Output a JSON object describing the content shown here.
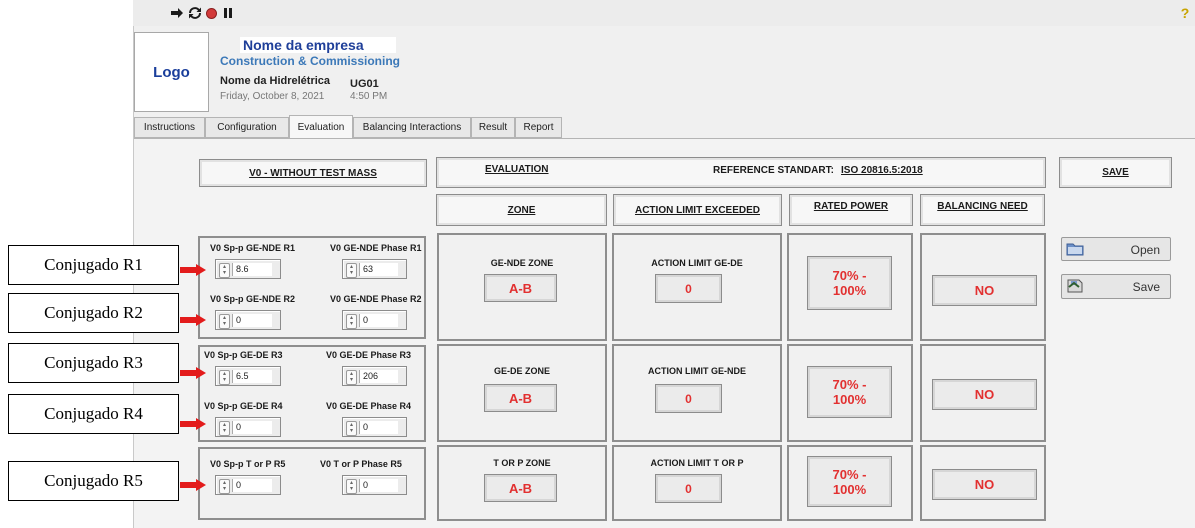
{
  "toolbar": {
    "icons": [
      "run-arrow-icon",
      "run-continuous-icon",
      "abort-icon",
      "pause-icon",
      "help-icon"
    ],
    "help_glyph": "?"
  },
  "header": {
    "logo": "Logo",
    "company_name": "Nome da empresa",
    "company_subtitle": "Construction & Commissioning",
    "plant_name": "Nome da Hidrelétrica",
    "date": "Friday, October 8, 2021",
    "unit": "UG01",
    "time": "4:50 PM"
  },
  "tabs": [
    {
      "label": "Instructions"
    },
    {
      "label": "Configuration"
    },
    {
      "label": "Evaluation",
      "active": true
    },
    {
      "label": "Balancing Interactions"
    },
    {
      "label": "Result"
    },
    {
      "label": "Report"
    }
  ],
  "evaluation": {
    "v0_title": "V0 - WITHOUT TEST MASS",
    "evaluation_title": "EVALUATION",
    "reference_label": "REFERENCE STANDART:",
    "reference_value": "ISO 20816.5:2018",
    "save_header": "SAVE",
    "columns": {
      "zone": "ZONE",
      "action": "ACTION LIMIT EXCEEDED",
      "rated": "RATED POWER",
      "balancing": "BALANCING NEED"
    },
    "inputs": [
      {
        "sp_label": "V0 Sp-p GE-NDE R1",
        "sp_value": "8.6",
        "ph_label": "V0 GE-NDE Phase R1",
        "ph_value": "63"
      },
      {
        "sp_label": "V0 Sp-p GE-NDE R2",
        "sp_value": "0",
        "ph_label": "V0 GE-NDE Phase R2",
        "ph_value": "0"
      },
      {
        "sp_label": "V0 Sp-p GE-DE R3",
        "sp_value": "6.5",
        "ph_label": "V0 GE-DE  Phase R3",
        "ph_value": "206"
      },
      {
        "sp_label": "V0 Sp-p GE-DE R4",
        "sp_value": "0",
        "ph_label": "V0 GE-DE Phase R4",
        "ph_value": "0"
      },
      {
        "sp_label": "V0 Sp-p  T or P R5",
        "sp_value": "0",
        "ph_label": "V0 T or P Phase R5",
        "ph_value": "0"
      }
    ],
    "rows": [
      {
        "zone_label": "GE-NDE ZONE",
        "zone_value": "A-B",
        "action_label": "ACTION LIMIT GE-DE",
        "action_value": "0",
        "rated_value": "70% - 100%",
        "balancing_value": "NO"
      },
      {
        "zone_label": "GE-DE ZONE",
        "zone_value": "A-B",
        "action_label": "ACTION LIMIT GE-NDE",
        "action_value": "0",
        "rated_value": "70% - 100%",
        "balancing_value": "NO"
      },
      {
        "zone_label": "T OR P ZONE",
        "zone_value": "A-B",
        "action_label": "ACTION LIMIT T OR P",
        "action_value": "0",
        "rated_value": "70% - 100%",
        "balancing_value": "NO"
      }
    ],
    "buttons": {
      "open": "Open",
      "save": "Save"
    }
  },
  "annotations": {
    "labels": [
      "Conjugado R1",
      "Conjugado R2",
      "Conjugado R3",
      "Conjugado R4",
      "Conjugado R5"
    ],
    "arrow_color": "#e31b1b"
  },
  "colors": {
    "indicator_text": "#e23030",
    "company_blue": "#1f3f99",
    "subtitle_blue": "#3b78b8"
  }
}
